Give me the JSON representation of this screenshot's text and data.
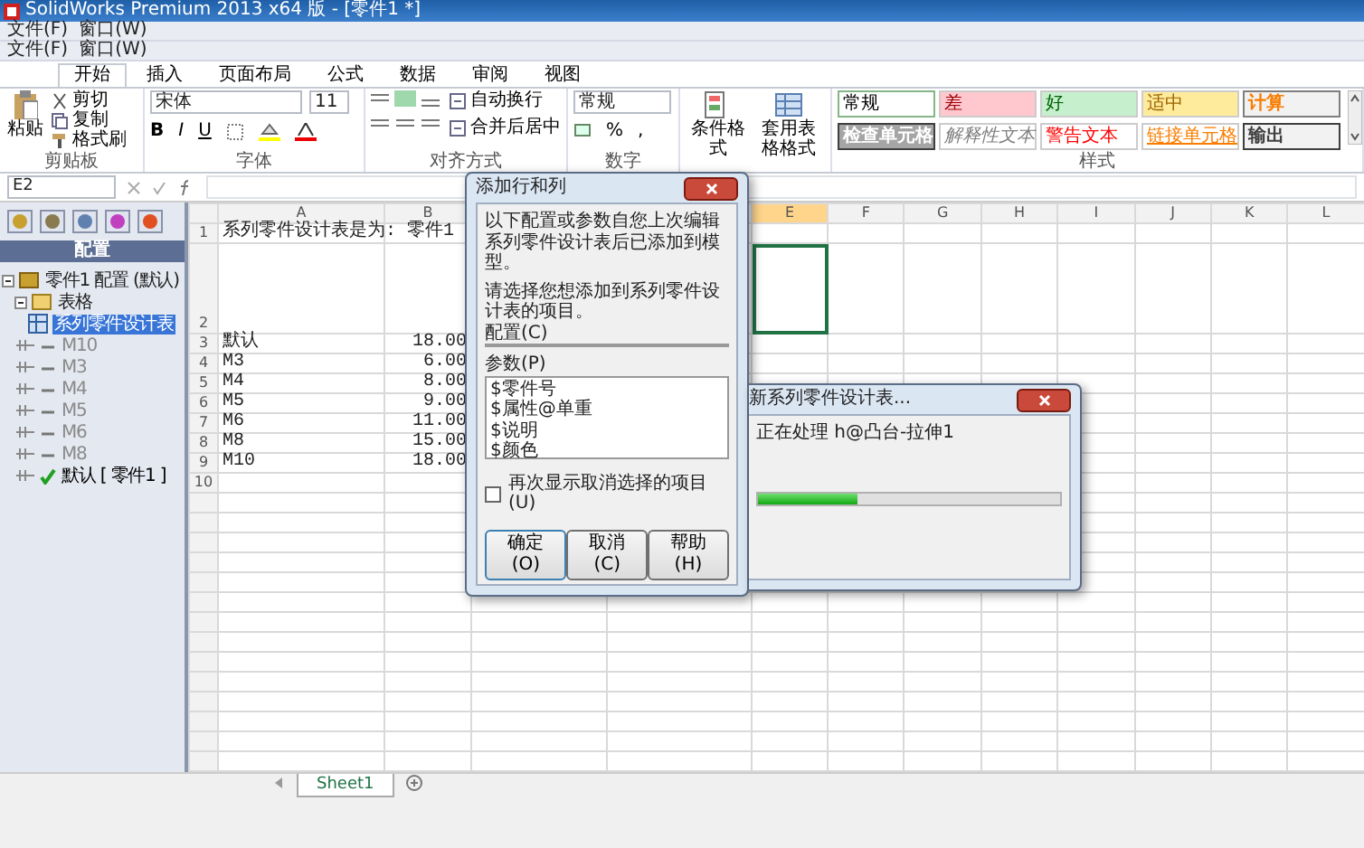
{
  "window": {
    "title": "SolidWorks Premium 2013 x64 版 - [零件1 *]"
  },
  "menubars": [
    [
      "文件(F)",
      "窗口(W)"
    ],
    [
      "文件(F)",
      "窗口(W)"
    ]
  ],
  "ribbon_tabs": [
    {
      "label": "开始",
      "selected": true
    },
    {
      "label": "插入",
      "selected": false
    },
    {
      "label": "页面布局",
      "selected": false
    },
    {
      "label": "公式",
      "selected": false
    },
    {
      "label": "数据",
      "selected": false
    },
    {
      "label": "审阅",
      "selected": false
    },
    {
      "label": "视图",
      "selected": false
    }
  ],
  "clipboard": {
    "paste": "粘贴",
    "items": [
      "剪切",
      "复制",
      "格式刷"
    ],
    "label": "剪贴板"
  },
  "font": {
    "name": "宋体",
    "size": "11",
    "buttons": [
      "B",
      "I",
      "U"
    ],
    "label": "字体"
  },
  "alignment": {
    "items": [
      "自动换行",
      "合并后居中"
    ],
    "label": "对齐方式"
  },
  "number": {
    "format": "常规",
    "buttons": [
      "%",
      ","
    ],
    "label": "数字"
  },
  "big_buttons": [
    "条件格式",
    "套用表格格式"
  ],
  "styles": {
    "label": "样式",
    "cells": [
      {
        "text": "常规",
        "kind": "normal"
      },
      {
        "text": "差",
        "kind": "bad"
      },
      {
        "text": "好",
        "kind": "good"
      },
      {
        "text": "适中",
        "kind": "neutral"
      },
      {
        "text": "计算",
        "kind": "calc"
      },
      {
        "text": "检查单元格",
        "kind": "check"
      },
      {
        "text": "解释性文本",
        "kind": "explain"
      },
      {
        "text": "警告文本",
        "kind": "warn"
      },
      {
        "text": "链接单元格",
        "kind": "link"
      },
      {
        "text": "输出",
        "kind": "output"
      }
    ]
  },
  "formula_bar": {
    "name_box": "E2"
  },
  "config_panel": {
    "header": "配置",
    "tree": [
      {
        "label": "零件1 配置 (默认)",
        "kind": "root",
        "expanded": true,
        "children": [
          {
            "label": "表格",
            "kind": "folder",
            "expanded": true,
            "children": [
              {
                "label": "系列零件设计表",
                "kind": "table",
                "selected": true
              }
            ]
          },
          {
            "label": "M10",
            "kind": "config",
            "active": false
          },
          {
            "label": "M3",
            "kind": "config",
            "active": false
          },
          {
            "label": "M4",
            "kind": "config",
            "active": false
          },
          {
            "label": "M5",
            "kind": "config",
            "active": false
          },
          {
            "label": "M6",
            "kind": "config",
            "active": false
          },
          {
            "label": "M8",
            "kind": "config",
            "active": false
          },
          {
            "label": "默认 [ 零件1 ]",
            "kind": "config",
            "active": true
          }
        ]
      }
    ]
  },
  "sheet": {
    "columns": [
      {
        "label": "A"
      },
      {
        "label": "B"
      },
      {},
      {},
      {
        "label": "E",
        "selected": true
      },
      {
        "label": "F"
      },
      {
        "label": "G"
      },
      {
        "label": "H"
      },
      {
        "label": "I"
      },
      {
        "label": "J"
      },
      {
        "label": "K"
      },
      {
        "label": "L"
      }
    ],
    "rows": [
      {
        "num": "1",
        "cells": [
          "系列零件设计表是为:  零件1"
        ]
      },
      {
        "num": "2",
        "tall": true,
        "cells": []
      },
      {
        "num": "3",
        "cells": [
          "默认",
          "18.00"
        ]
      },
      {
        "num": "4",
        "cells": [
          "M3",
          "6.00"
        ]
      },
      {
        "num": "5",
        "cells": [
          "M4",
          "8.00"
        ]
      },
      {
        "num": "6",
        "cells": [
          "M5",
          "9.00"
        ]
      },
      {
        "num": "7",
        "cells": [
          "M6",
          "11.00"
        ]
      },
      {
        "num": "8",
        "cells": [
          "M8",
          "15.00"
        ]
      },
      {
        "num": "9",
        "cells": [
          "M10",
          "18.00"
        ]
      },
      {
        "num": "10",
        "cells": []
      }
    ],
    "sheet_tabs": [
      {
        "label": "Sheet1",
        "selected": true
      }
    ]
  },
  "add_dialog": {
    "title": "添加行和列",
    "message": "以下配置或参数自您上次编辑系列零件设计表后已添加到模型。",
    "prompt": "请选择您想添加到系列零件设计表的项目。",
    "configs_label": "配置(C)",
    "params_label": "参数(P)",
    "params": [
      "$零件号",
      "$属性@单重",
      "$说明",
      "$颜色"
    ],
    "checkbox": {
      "label": "再次显示取消选择的项目(U)",
      "checked": false
    },
    "buttons": [
      "确定(O)",
      "取消(C)",
      "帮助(H)"
    ]
  },
  "progress_dialog": {
    "title": "新系列零件设计表...",
    "message": "正在处理 h@凸台-拉伸1",
    "level": 0.33
  }
}
